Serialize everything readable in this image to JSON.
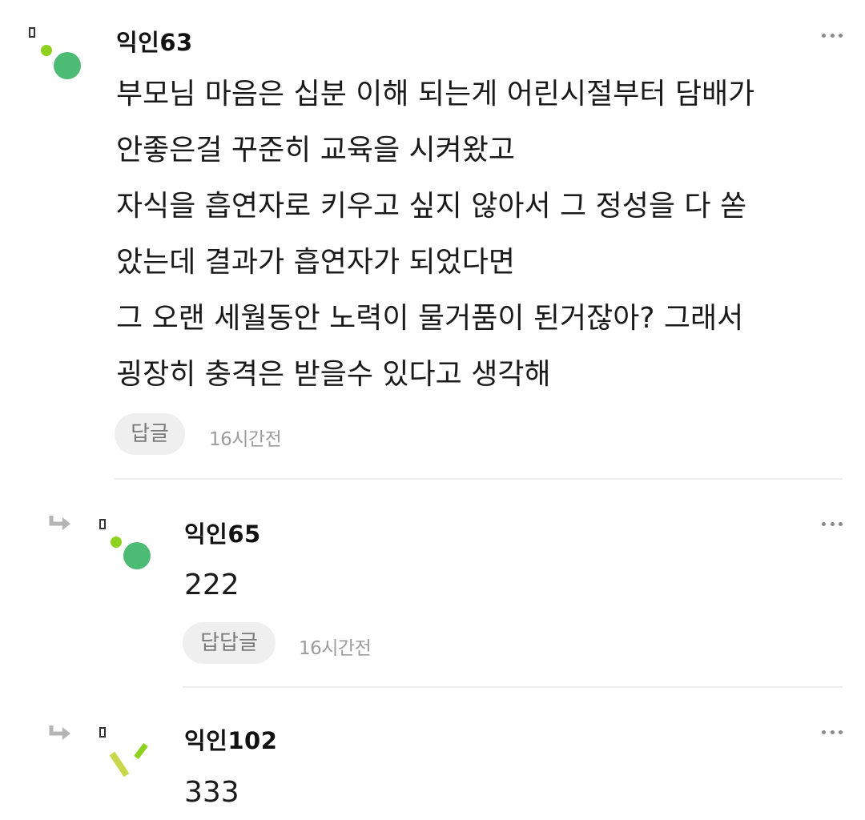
{
  "comments": [
    {
      "username": "익인63",
      "lines": [
        "부모님 마음은 십분 이해 되는게 어린시절부터 담배가",
        "안좋은걸 꾸준히 교육을 시켜왔고",
        "자식을 흡연자로 키우고 싶지 않아서 그 정성을 다 쏟",
        "았는데 결과가 흡연자가 되었다면",
        "그 오랜 세월동안 노력이 물거품이 된거잖아? 그래서",
        "굉장히 충격은 받을수 있다고 생각해"
      ],
      "reply_label": "답글",
      "time": "16시간전"
    },
    {
      "username": "익인65",
      "lines": [
        "222"
      ],
      "reply_label": "답답글",
      "time": "16시간전"
    },
    {
      "username": "익인102",
      "lines": [
        "333"
      ]
    }
  ],
  "colors": {
    "avatar_light_green": "#8fd11f",
    "avatar_green": "#4cbc74",
    "avatar_lime": "#c8d84a",
    "button_bg": "#efefef",
    "divider": "#ececec"
  },
  "icons": {
    "more": "more-icon",
    "reply_arrow": "reply-arrow-icon"
  }
}
